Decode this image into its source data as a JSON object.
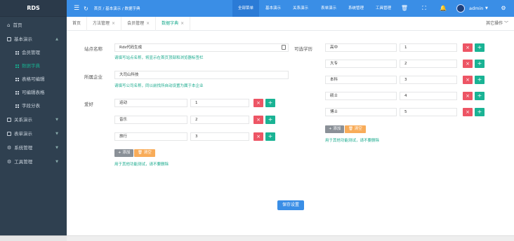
{
  "app": {
    "logo": "RDS"
  },
  "sidebar": {
    "items": [
      {
        "label": "首页"
      },
      {
        "label": "基本演示"
      },
      {
        "label": "关系演示"
      },
      {
        "label": "表单演示"
      },
      {
        "label": "系统管理"
      },
      {
        "label": "工具管理"
      }
    ],
    "subitems": [
      {
        "label": "会员管理"
      },
      {
        "label": "数据字典"
      },
      {
        "label": "表格可编辑"
      },
      {
        "label": "可编辑表格"
      },
      {
        "label": "字段分表"
      }
    ]
  },
  "topbar": {
    "breadcrumb": "首页 / 基本演示 / 数据字典",
    "nav": [
      "全部菜单",
      "基本演示",
      "关系演示",
      "表单演示",
      "系统管理",
      "工具管理"
    ],
    "user": "admin",
    "accent": "#3a8ee6"
  },
  "tabs": {
    "items": [
      "首页",
      "方法管理",
      "会员管理",
      "数据字典"
    ],
    "other_ops": "其它操作"
  },
  "form": {
    "site_name_label": "站点名称",
    "site_name_value": "Rds代码生成",
    "site_name_help": "请填写站点名称，将显示在首页顶部和浏览器标签栏",
    "company_label": "所属企业",
    "company_value": "大司山科技",
    "company_help": "请填写公司名称，同以前找所自动设置为属于本企业",
    "hobby_label": "爱好",
    "hobbies": [
      {
        "name": "运动",
        "value": "1"
      },
      {
        "name": "音乐",
        "value": "2"
      },
      {
        "name": "旅行",
        "value": "3"
      }
    ],
    "education_label": "可选学历",
    "educations": [
      {
        "name": "高中",
        "value": "1"
      },
      {
        "name": "大专",
        "value": "2"
      },
      {
        "name": "本科",
        "value": "3"
      },
      {
        "name": "硕士",
        "value": "4"
      },
      {
        "name": "博士",
        "value": "5"
      }
    ],
    "add_label": "添加",
    "clear_label": "清空",
    "note": "用于其他功能测试，请不要删除",
    "save_label": "保存设置"
  }
}
